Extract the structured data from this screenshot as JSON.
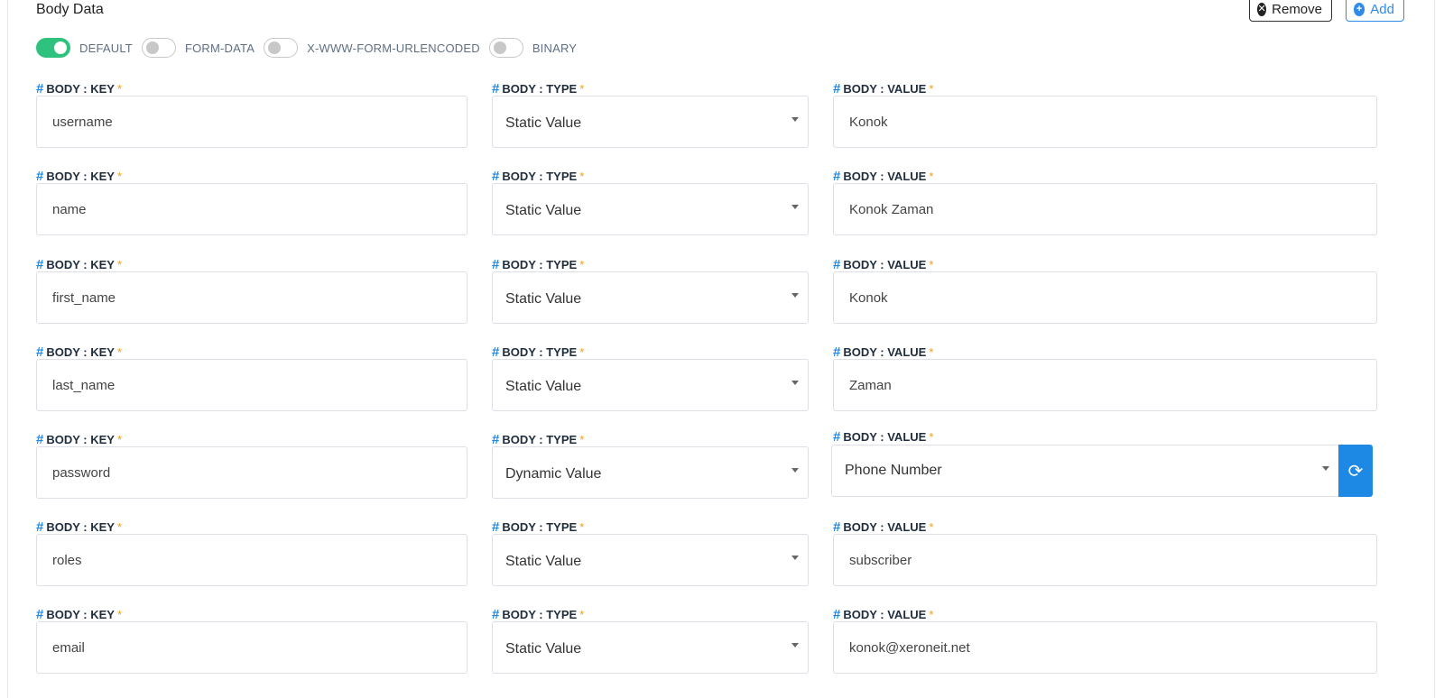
{
  "header": {
    "title": "Body Data",
    "remove_label": "Remove",
    "add_label": "Add"
  },
  "toggles": [
    {
      "label": "DEFAULT",
      "on": true
    },
    {
      "label": "FORM-DATA",
      "on": false
    },
    {
      "label": "X-WWW-FORM-URLENCODED",
      "on": false
    },
    {
      "label": "BINARY",
      "on": false
    }
  ],
  "field_labels": {
    "hash": "#",
    "key": "BODY : KEY",
    "type": "BODY : TYPE",
    "value": "BODY : VALUE",
    "required": "*"
  },
  "rows": [
    {
      "key": "username",
      "type": "Static Value",
      "value": "Konok",
      "dynamic": false
    },
    {
      "key": "name",
      "type": "Static Value",
      "value": "Konok Zaman",
      "dynamic": false
    },
    {
      "key": "first_name",
      "type": "Static Value",
      "value": "Konok",
      "dynamic": false
    },
    {
      "key": "last_name",
      "type": "Static Value",
      "value": "Zaman",
      "dynamic": false
    },
    {
      "key": "password",
      "type": "Dynamic Value",
      "value": "Phone Number",
      "dynamic": true
    },
    {
      "key": "roles",
      "type": "Static Value",
      "value": "subscriber",
      "dynamic": false
    },
    {
      "key": "email",
      "type": "Static Value",
      "value": "konok@xeroneit.net",
      "dynamic": false
    }
  ],
  "colors": {
    "accent": "#1e88e5",
    "toggle_on": "#2ec27e",
    "required_star": "#f39c12"
  },
  "icons": {
    "remove": "times-circle-icon",
    "add": "plus-circle-icon",
    "refresh": "refresh-icon"
  }
}
